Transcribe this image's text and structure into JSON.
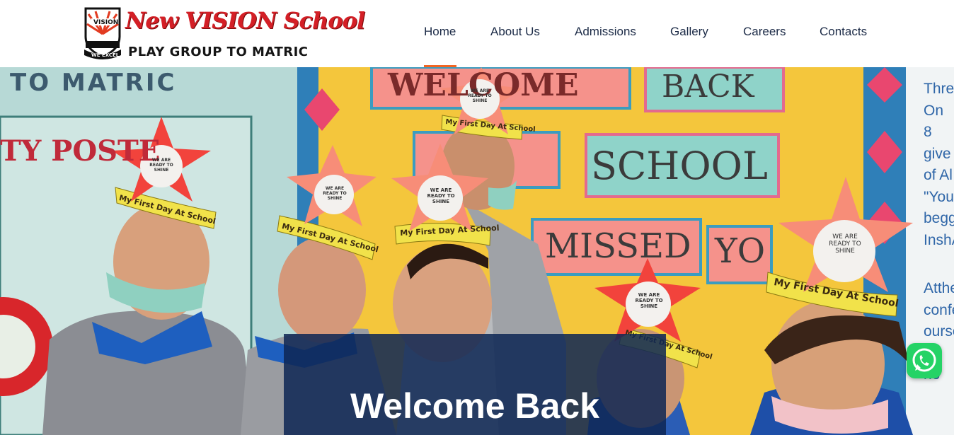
{
  "logo": {
    "shield_top": "VISION",
    "shield_bottom": "WE EXCEL",
    "name": "New VISION School",
    "tagline": "PLAY GROUP TO MATRIC"
  },
  "nav": {
    "items": [
      {
        "label": "Home",
        "active": true
      },
      {
        "label": "About Us"
      },
      {
        "label": "Admissions"
      },
      {
        "label": "Gallery"
      },
      {
        "label": "Careers"
      },
      {
        "label": "Contacts"
      }
    ],
    "active_color": "#f26522"
  },
  "hero": {
    "title": "Welcome Back",
    "board_words": [
      "TO MATRIC",
      "TY POSTE",
      "WELCOME",
      "BACK",
      "SCHOOL",
      "MISSED",
      "YO"
    ],
    "crown_label": "My First Day At School",
    "star_label": "WE ARE READY TO SHINE",
    "right_poster_lines": [
      "Thre",
      "On 8",
      "give",
      "of Al",
      "\"You",
      "begg",
      "InshA",
      "Atthe",
      "confe",
      "ourse",
      "be no"
    ]
  },
  "whatsapp": {
    "icon": "whatsapp-icon",
    "color": "#25d366"
  }
}
